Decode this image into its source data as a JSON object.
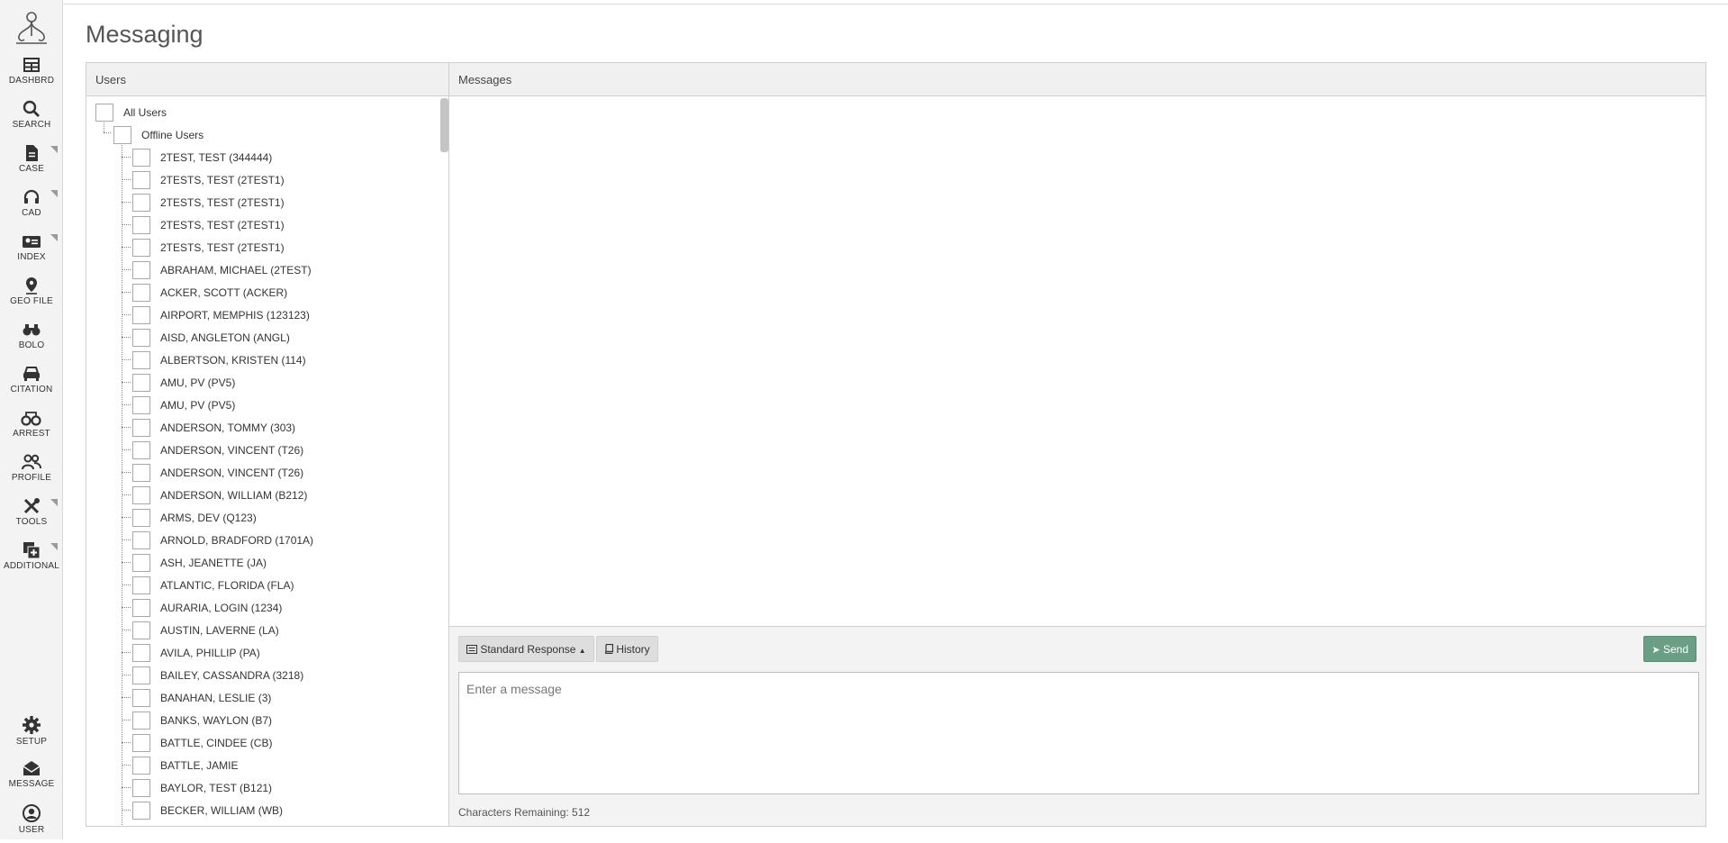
{
  "page": {
    "title": "Messaging"
  },
  "sidebar": {
    "items": [
      {
        "label": "DASHBRD",
        "icon": "dashboard-icon",
        "submenu": false
      },
      {
        "label": "SEARCH",
        "icon": "search-icon",
        "submenu": false
      },
      {
        "label": "CASE",
        "icon": "document-icon",
        "submenu": true
      },
      {
        "label": "CAD",
        "icon": "headset-icon",
        "submenu": true
      },
      {
        "label": "INDEX",
        "icon": "id-card-icon",
        "submenu": true
      },
      {
        "label": "GEO FILE",
        "icon": "map-pin-icon",
        "submenu": false
      },
      {
        "label": "BOLO",
        "icon": "binoculars-icon",
        "submenu": false
      },
      {
        "label": "CITATION",
        "icon": "car-icon",
        "submenu": false
      },
      {
        "label": "ARREST",
        "icon": "handcuffs-icon",
        "submenu": false
      },
      {
        "label": "PROFILE",
        "icon": "users-icon",
        "submenu": false
      },
      {
        "label": "TOOLS",
        "icon": "tools-icon",
        "submenu": true
      },
      {
        "label": "ADDITIONAL",
        "icon": "plus-square-icon",
        "submenu": true
      }
    ],
    "bottom_items": [
      {
        "label": "SETUP",
        "icon": "gear-icon"
      },
      {
        "label": "MESSAGE",
        "icon": "envelope-open-icon"
      },
      {
        "label": "USER",
        "icon": "user-circle-icon"
      }
    ]
  },
  "users_panel": {
    "header": "Users",
    "root": "All Users",
    "group": "Offline Users",
    "users": [
      "2TEST, TEST (344444)",
      "2TESTS, TEST (2TEST1)",
      "2TESTS, TEST (2TEST1)",
      "2TESTS, TEST (2TEST1)",
      "2TESTS, TEST (2TEST1)",
      "ABRAHAM, MICHAEL (2TEST)",
      "ACKER, SCOTT (ACKER)",
      "AIRPORT, MEMPHIS (123123)",
      "AISD, ANGLETON (ANGL)",
      "ALBERTSON, KRISTEN (114)",
      "AMU, PV (PV5)",
      "AMU, PV (PV5)",
      "ANDERSON, TOMMY (303)",
      "ANDERSON, VINCENT (T26)",
      "ANDERSON, VINCENT (T26)",
      "ANDERSON, WILLIAM (B212)",
      "ARMS, DEV (Q123)",
      "ARNOLD, BRADFORD (1701A)",
      "ASH, JEANETTE (JA)",
      "ATLANTIC, FLORIDA (FLA)",
      "AURARIA, LOGIN (1234)",
      "AUSTIN, LAVERNE (LA)",
      "AVILA, PHILLIP (PA)",
      "BAILEY, CASSANDRA (3218)",
      "BANAHAN, LESLIE (3)",
      "BANKS, WAYLON (B7)",
      "BATTLE, CINDEE (CB)",
      "BATTLE, JAMIE",
      "BAYLOR, TEST (B121)",
      "BECKER, WILLIAM (WB)"
    ]
  },
  "messages_panel": {
    "header": "Messages",
    "standard_response_label": "Standard Response",
    "history_label": "History",
    "send_label": "Send",
    "input_placeholder": "Enter a message",
    "chars_remaining": "Characters Remaining: 512"
  },
  "colors": {
    "send_button": "#6a9f86",
    "sidebar_bg": "#f3f3f3",
    "panel_header_bg": "#f0f0f0"
  }
}
